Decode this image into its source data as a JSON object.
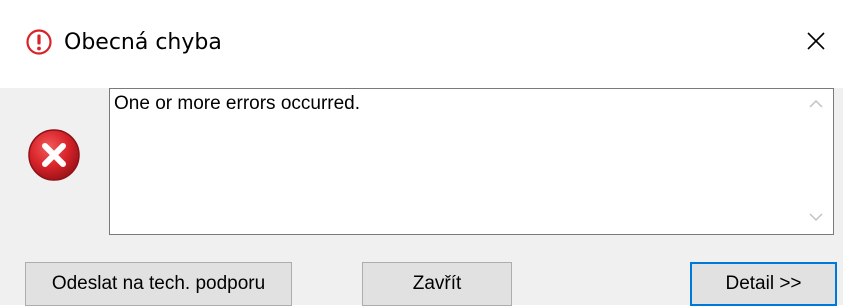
{
  "window": {
    "title": "Obecná chyba",
    "title_icon": "warning-circle-icon",
    "close_icon": "close-icon"
  },
  "message": {
    "text": "One or more errors occurred.",
    "icon": "error-icon"
  },
  "buttons": {
    "support_label": "Odeslat na tech. podporu",
    "close_label": "Zavřít",
    "detail_label": "Detail >>"
  },
  "colors": {
    "error_red": "#d8232a",
    "focus_blue": "#0078d7",
    "client_bg": "#f0f0f0"
  }
}
